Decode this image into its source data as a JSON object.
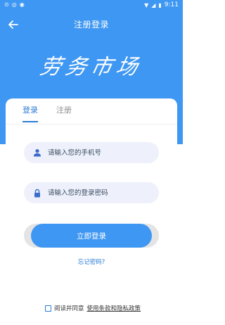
{
  "status_bar": {
    "time": "9:11"
  },
  "appbar": {
    "title": "注册登录"
  },
  "logo": {
    "text": "劳务市场"
  },
  "tabs": [
    {
      "label": "登录",
      "active": true
    },
    {
      "label": "注册",
      "active": false
    }
  ],
  "form": {
    "phone_placeholder": "请输入您的手机号",
    "password_placeholder": "请输入您的登录密码",
    "login_label": "立即登录",
    "forgot_label": "忘记密码?",
    "agree_label": "阅读并同意",
    "policy_label": "使用条款和隐私政策"
  },
  "colors": {
    "primary": "#3e97f2",
    "field_bg": "#eef1fb"
  }
}
